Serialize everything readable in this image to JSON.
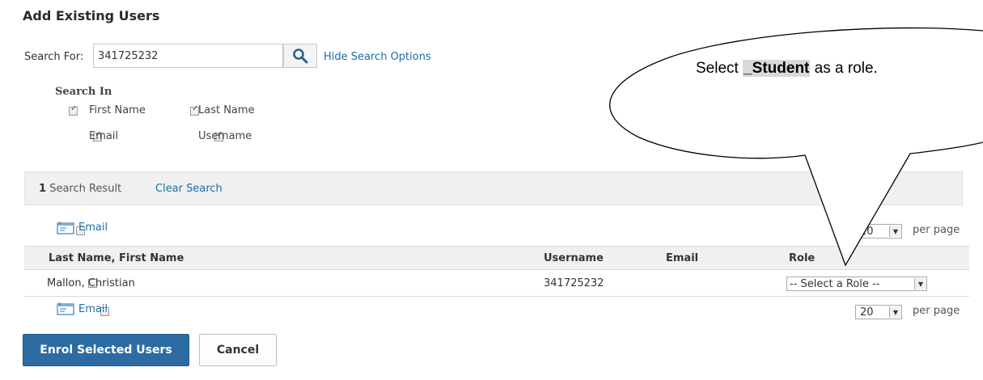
{
  "page": {
    "title": "Add Existing Users"
  },
  "search": {
    "label": "Search For:",
    "value": "341725232",
    "hide_options_link": "Hide Search Options",
    "search_in_heading": "Search In",
    "options": [
      {
        "label": "First Name",
        "checked": true
      },
      {
        "label": "Last Name",
        "checked": true
      },
      {
        "label": "Email",
        "checked": true
      },
      {
        "label": "Username",
        "checked": true
      }
    ]
  },
  "results": {
    "count": "1",
    "count_label": "Search Result",
    "clear_link": "Clear Search"
  },
  "toolbar": {
    "email_label": "Email",
    "per_page_value": "20",
    "per_page_label": "per page"
  },
  "table": {
    "columns": [
      "Last Name, First Name",
      "Username",
      "Email",
      "Role"
    ],
    "rows": [
      {
        "name": "Mallon, Christian",
        "username": "341725232",
        "email": "",
        "role": "-- Select a Role --"
      }
    ]
  },
  "actions": {
    "enrol_label": "Enrol Selected Users",
    "cancel_label": "Cancel"
  },
  "callout": {
    "prefix": "Select ",
    "highlight": "_Student",
    "suffix": " as a role."
  },
  "colors": {
    "link": "#1c6ea4",
    "primary_button": "#2c6ca3",
    "header_bg": "#f0f0f0"
  }
}
